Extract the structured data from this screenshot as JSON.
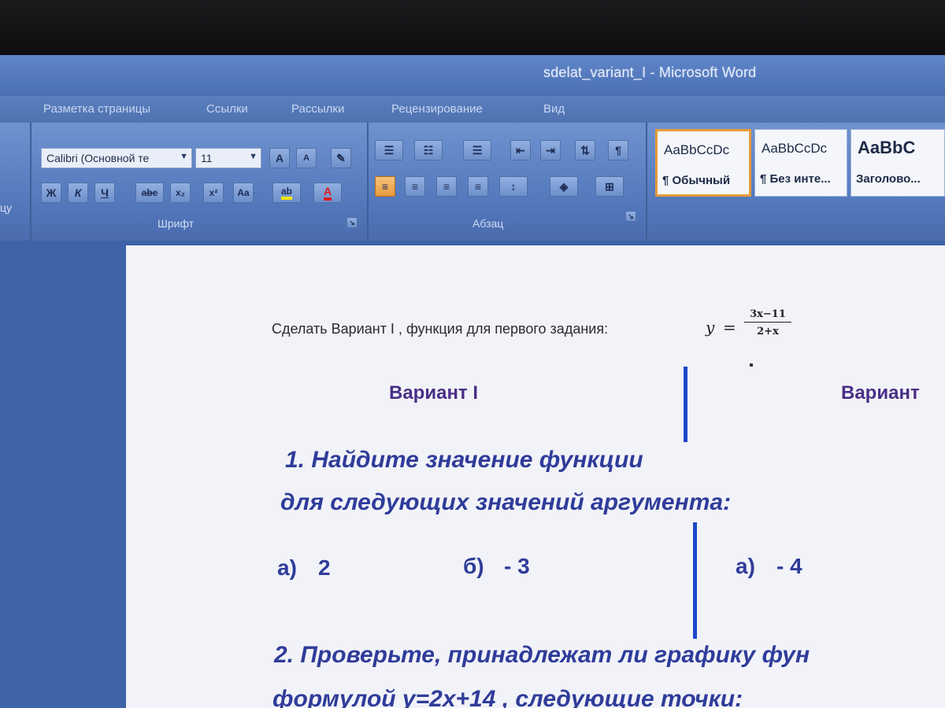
{
  "window": {
    "title": "sdelat_variant_I - Microsoft Word"
  },
  "ribbon": {
    "tabs": [
      "Разметка страницы",
      "Ссылки",
      "Рассылки",
      "Рецензирование",
      "Вид"
    ],
    "left_fragment": "цу",
    "font": {
      "name": "Calibri (Основной те",
      "size": "11",
      "group_label": "Шрифт"
    },
    "paragraph": {
      "group_label": "Абзац"
    },
    "styles": [
      {
        "sample": "AaBbCcDc",
        "name": "¶ Обычный",
        "selected": true
      },
      {
        "sample": "AaBbCcDc",
        "name": "¶ Без инте...",
        "selected": false
      },
      {
        "sample": "AaBbC",
        "name": "Заголово...",
        "selected": false
      }
    ],
    "colors": {
      "accent_selected": "#e69b3a",
      "highlight": "#f2e500",
      "font_color": "#e01b1b"
    }
  },
  "document": {
    "intro": "Сделать Вариант I , функция для первого задания:",
    "formula": {
      "lhs": "y",
      "eq": "=",
      "numerator": "3x−11",
      "denominator": "2+x"
    },
    "variant_1": "Вариант I",
    "variant_2": "Вариант",
    "task1_line1": "1. Найдите значение функции",
    "task1_line2": "для следующих значений аргумента:",
    "answers": [
      {
        "label": "а)",
        "value": "2"
      },
      {
        "label": "б)",
        "value": "- 3"
      },
      {
        "label": "а)",
        "value": "- 4"
      }
    ],
    "task2_line1": "2. Проверьте, принадлежат ли графику фун",
    "task2_line2": "формулой  y=2x+14 , следующие точки:"
  }
}
